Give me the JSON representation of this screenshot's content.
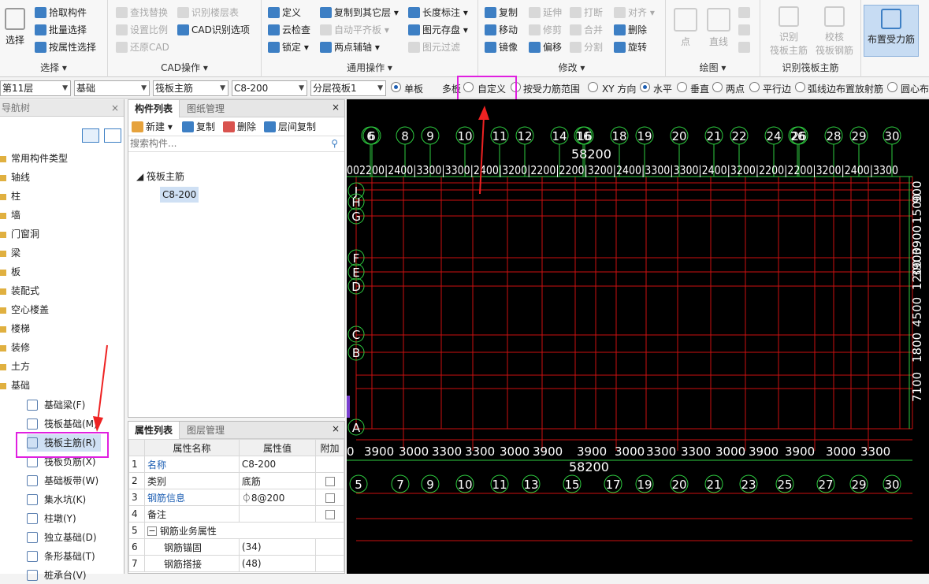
{
  "ribbon": {
    "select": {
      "big": "选择",
      "items": [
        "拾取构件",
        "批量选择",
        "按属性选择"
      ],
      "title": "选择"
    },
    "cad": {
      "items": [
        "查找替换",
        "识别楼层表",
        "设置比例",
        "CAD识别选项",
        "还原CAD"
      ],
      "title": "CAD操作"
    },
    "common": {
      "items": [
        "定义",
        "复制到其它层",
        "长度标注",
        "云检查",
        "自动平齐板",
        "图元存盘",
        "锁定",
        "两点辅轴",
        "图元过滤"
      ],
      "title": "通用操作"
    },
    "modify": {
      "items": [
        "复制",
        "延伸",
        "打断",
        "对齐",
        "移动",
        "修剪",
        "合并",
        "删除",
        "镜像",
        "偏移",
        "分割",
        "旋转"
      ],
      "title": "修改"
    },
    "draw": {
      "items": [
        "点",
        "直线"
      ],
      "title": "绘图"
    },
    "identify": {
      "items": [
        "识别",
        "筏板主筋",
        "校核",
        "筏板钢筋"
      ],
      "title": "识别筏板主筋"
    },
    "place": {
      "label": "布置受力筋"
    }
  },
  "toolbar2": {
    "floor": "第11层",
    "category": "基础",
    "type": "筏板主筋",
    "spec": "C8-200",
    "layer": "分层筏板1",
    "radios": [
      "单板",
      "多板",
      "自定义",
      "按受力筋范围",
      "XY 方向",
      "水平",
      "垂直",
      "两点",
      "平行边",
      "弧线边布置放射筋",
      "圆心布"
    ]
  },
  "nav": {
    "title": "导航树",
    "items": [
      "常用构件类型",
      "轴线",
      "柱",
      "墙",
      "门窗洞",
      "梁",
      "板",
      "装配式",
      "空心楼盖",
      "楼梯",
      "装修",
      "土方",
      "基础"
    ],
    "subitems": [
      "基础梁(F)",
      "筏板基础(M)",
      "筏板主筋(R)",
      "筏板负筋(X)",
      "基础板带(W)",
      "集水坑(K)",
      "柱墩(Y)",
      "独立基础(D)",
      "条形基础(T)",
      "桩承台(V)"
    ]
  },
  "comp": {
    "tabs": [
      "构件列表",
      "图纸管理"
    ],
    "actions": [
      "新建",
      "复制",
      "删除",
      "层间复制"
    ],
    "search_placeholder": "搜索构件...",
    "tree_parent": "筏板主筋",
    "tree_child": "C8-200"
  },
  "props": {
    "tabs": [
      "属性列表",
      "图层管理"
    ],
    "headers": [
      "",
      "属性名称",
      "属性值",
      "附加"
    ],
    "rows": [
      {
        "n": "1",
        "name": "名称",
        "value": "C8-200"
      },
      {
        "n": "2",
        "name": "类别",
        "value": "底筋"
      },
      {
        "n": "3",
        "name": "钢筋信息",
        "value": "⏀8@200"
      },
      {
        "n": "4",
        "name": "备注",
        "value": ""
      },
      {
        "n": "5",
        "name": "钢筋业务属性",
        "value": ""
      },
      {
        "n": "6",
        "name": "钢筋锚固",
        "value": "(34)"
      },
      {
        "n": "7",
        "name": "钢筋搭接",
        "value": "(48)"
      }
    ]
  },
  "canvas": {
    "top_axes": [
      "6",
      "6",
      "8",
      "9",
      "10",
      "11",
      "12",
      "14",
      "16",
      "16",
      "18",
      "19",
      "20",
      "21",
      "22",
      "24",
      "26",
      "26",
      "28",
      "29",
      "30"
    ],
    "top_total": "58200",
    "top_dims": "002200|2400|3300|3300|2400|3200|2200|2200|3200|2400|3300|3300|2400|3200|2200|2200|3200|2400|3300",
    "bottom_axes": [
      "5",
      "7",
      "9",
      "10",
      "11",
      "13",
      "15",
      "17",
      "19",
      "20",
      "21",
      "23",
      "25",
      "27",
      "29",
      "30"
    ],
    "bottom_total": "58200",
    "bottom_dims": [
      "0",
      "3900",
      "3000",
      "3300",
      "3300",
      "3000",
      "3900",
      "3900",
      "3000",
      "3300",
      "3300",
      "3000",
      "3900",
      "3900",
      "3000",
      "3300"
    ],
    "rows": [
      "J",
      "H",
      "G",
      "F",
      "E",
      "D",
      "C",
      "B",
      "A"
    ],
    "right_dims": [
      "900",
      "1500",
      "3900",
      "3900",
      "1200",
      "4500",
      "1800",
      "7100"
    ],
    "colors": {
      "grid": "#cc1010",
      "axis": "#2ecc40",
      "text": "#ffffff",
      "highlight": "#e020e0"
    }
  }
}
